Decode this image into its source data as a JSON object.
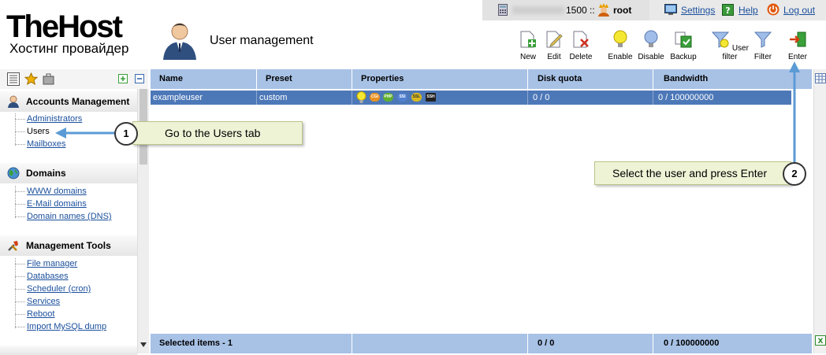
{
  "header": {
    "logo_main": "TheHost",
    "logo_sub": "Хостинг провайдер",
    "page_title": "User management",
    "user_id": "1500 ::",
    "username": "root",
    "links": {
      "settings": "Settings",
      "help": "Help",
      "logout": "Log out"
    }
  },
  "toolbar": {
    "new": "New",
    "edit": "Edit",
    "delete": "Delete",
    "enable": "Enable",
    "disable": "Disable",
    "backup": "Backup",
    "user_filter": "User filter",
    "filter": "Filter",
    "enter": "Enter"
  },
  "sidebar": {
    "sections": [
      {
        "title": "Accounts Management",
        "items": [
          "Administrators",
          "Users",
          "Mailboxes"
        ]
      },
      {
        "title": "Domains",
        "items": [
          "WWW domains",
          "E-Mail domains",
          "Domain names (DNS)"
        ]
      },
      {
        "title": "Management Tools",
        "items": [
          "File manager",
          "Databases",
          "Scheduler (cron)",
          "Services",
          "Reboot",
          "Import MySQL dump"
        ]
      }
    ]
  },
  "table": {
    "columns": [
      "Name",
      "Preset",
      "Properties",
      "Disk quota",
      "Bandwidth"
    ],
    "rows": [
      {
        "name": "exampleuser",
        "preset": "custom",
        "disk_quota": "0 / 0",
        "bandwidth": "0 / 100000000",
        "badges": [
          "CGI",
          "PHP",
          "SSI",
          "SSL",
          "SSH"
        ]
      }
    ],
    "footer": {
      "selected": "Selected items - 1",
      "disk_quota": "0 / 0",
      "bandwidth": "0 / 100000000"
    }
  },
  "callouts": [
    {
      "num": "1",
      "text": "Go to the Users tab"
    },
    {
      "num": "2",
      "text": "Select the user and press Enter"
    }
  ],
  "colors": {
    "header_blue": "#a8c2e6",
    "selected_row": "#4d78b8",
    "link": "#1a4f9c",
    "callout_bg": "#eef3d6"
  }
}
